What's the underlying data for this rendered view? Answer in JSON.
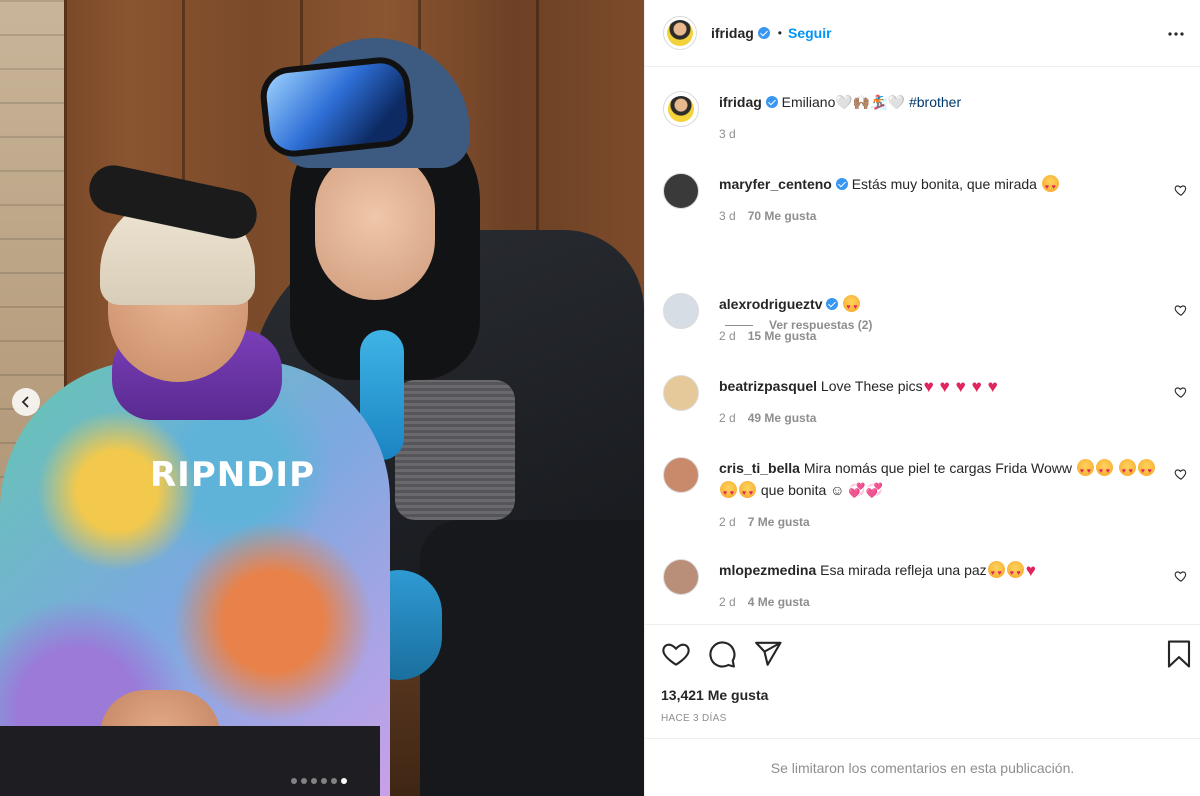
{
  "post": {
    "author": "ifridag",
    "follow_label": "Seguir",
    "separator": "•",
    "caption_author": "ifridag",
    "caption_text": "Emiliano🤍🙌🏽🏂🏼🤍",
    "caption_hashtag": "#brother",
    "caption_time": "3 d",
    "likes": "13,421 Me gusta",
    "posted_ago": "HACE 3 DÍAS",
    "comments_limited": "Se limitaron los comentarios en esta publicación.",
    "photo_print": "RIPNDIP",
    "carousel": {
      "total": 6,
      "active": 6
    }
  },
  "comments": [
    {
      "user": "maryfer_centeno",
      "verified": true,
      "text": "Estás muy bonita, que mirada",
      "time": "3 d",
      "likes": "70 Me gusta"
    },
    {
      "user": "alexrodrigueztv",
      "verified": true,
      "text": "",
      "time": "2 d",
      "likes": "15 Me gusta"
    },
    {
      "user": "beatrizpasquel",
      "verified": false,
      "text": "Love These pics",
      "time": "2 d",
      "likes": "49 Me gusta"
    },
    {
      "user": "cris_ti_bella",
      "verified": false,
      "text": "Mira nomás que piel te cargas Frida Woww",
      "text2": "que bonita ☺ 💞💞",
      "time": "2 d",
      "likes": "7 Me gusta"
    },
    {
      "user": "mlopezmedina",
      "verified": false,
      "text": "Esa mirada refleja una paz",
      "time": "2 d",
      "likes": "4 Me gusta"
    }
  ],
  "replies_label": "Ver respuestas (2)",
  "icons": {
    "more": "more-options-icon",
    "like": "heart-icon",
    "comment": "comment-icon",
    "share": "share-icon",
    "save": "bookmark-icon",
    "prev": "chevron-left-icon"
  },
  "colors": {
    "link": "#0095f6",
    "verified": "#3897f0",
    "muted": "#8e8e8e",
    "hashtag": "#00376b"
  }
}
